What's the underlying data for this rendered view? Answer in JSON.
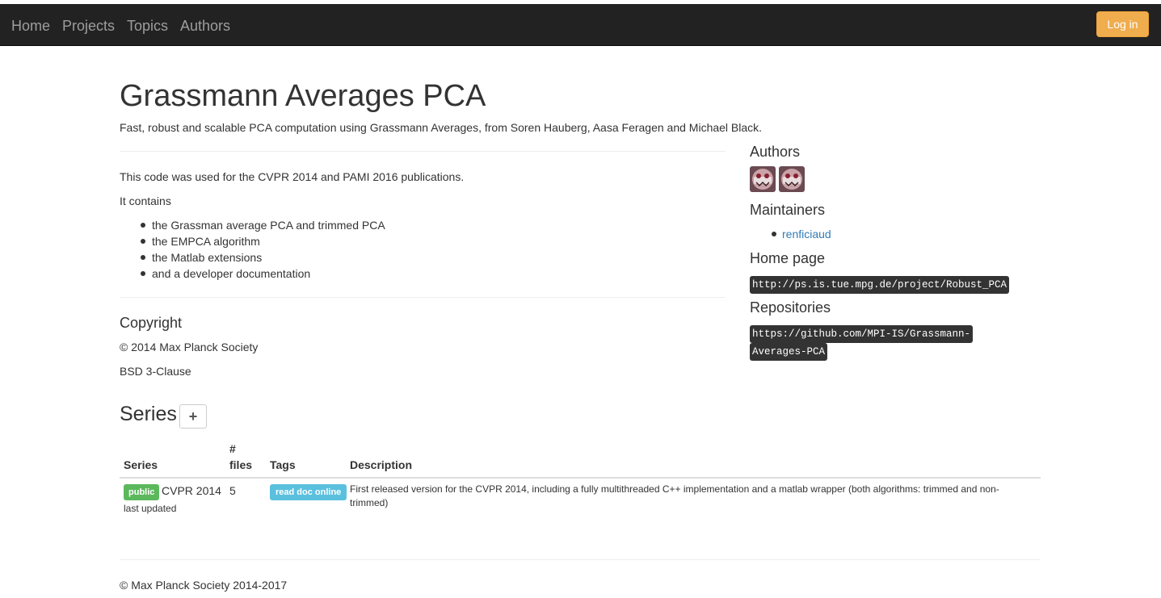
{
  "navbar": {
    "links": [
      "Home",
      "Projects",
      "Topics",
      "Authors"
    ],
    "login_label": "Log in"
  },
  "project": {
    "title": "Grassmann Averages PCA",
    "subtitle": "Fast, robust and scalable PCA computation using Grassmann Averages, from Soren Hauberg, Aasa Feragen and Michael Black.",
    "intro": "This code was used for the CVPR 2014 and PAMI 2016 publications.",
    "contains_label": "It contains",
    "contents": [
      "the Grassman average PCA and trimmed PCA",
      "the EMPCA algorithm",
      "the Matlab extensions",
      "and a developer documentation"
    ],
    "copyright_heading": "Copyright",
    "copyright_text": "© 2014 Max Planck Society",
    "license": "BSD 3-Clause"
  },
  "sidebar": {
    "authors_heading": "Authors",
    "maintainers_heading": "Maintainers",
    "maintainers": [
      "renficiaud"
    ],
    "homepage_heading": "Home page",
    "homepage_url": "http://ps.is.tue.mpg.de/project/Robust_PCA",
    "repositories_heading": "Repositories",
    "repository_url_line1": "https://github.com/MPI-IS/Grassmann-",
    "repository_url_line2": "Averages-PCA"
  },
  "series": {
    "heading": "Series",
    "add_label": "+",
    "columns": {
      "series": "Series",
      "files_line1": "#",
      "files_line2": "files",
      "tags": "Tags",
      "description": "Description"
    },
    "rows": [
      {
        "visibility": "public",
        "name": "CVPR 2014",
        "updated_label": "last updated",
        "files": "5",
        "tag": "read doc online",
        "description": "First released version for the CVPR 2014, including a fully multithreaded C++ implementation and a matlab wrapper (both algorithms: trimmed and non-trimmed)"
      }
    ]
  },
  "footer": {
    "text": "© Max Planck Society 2014-2017"
  },
  "colors": {
    "navbar_bg": "#222222",
    "login_btn": "#f0ad4e",
    "public_label": "#5cb85c",
    "tag_label": "#5bc0de",
    "link": "#337ab7"
  }
}
